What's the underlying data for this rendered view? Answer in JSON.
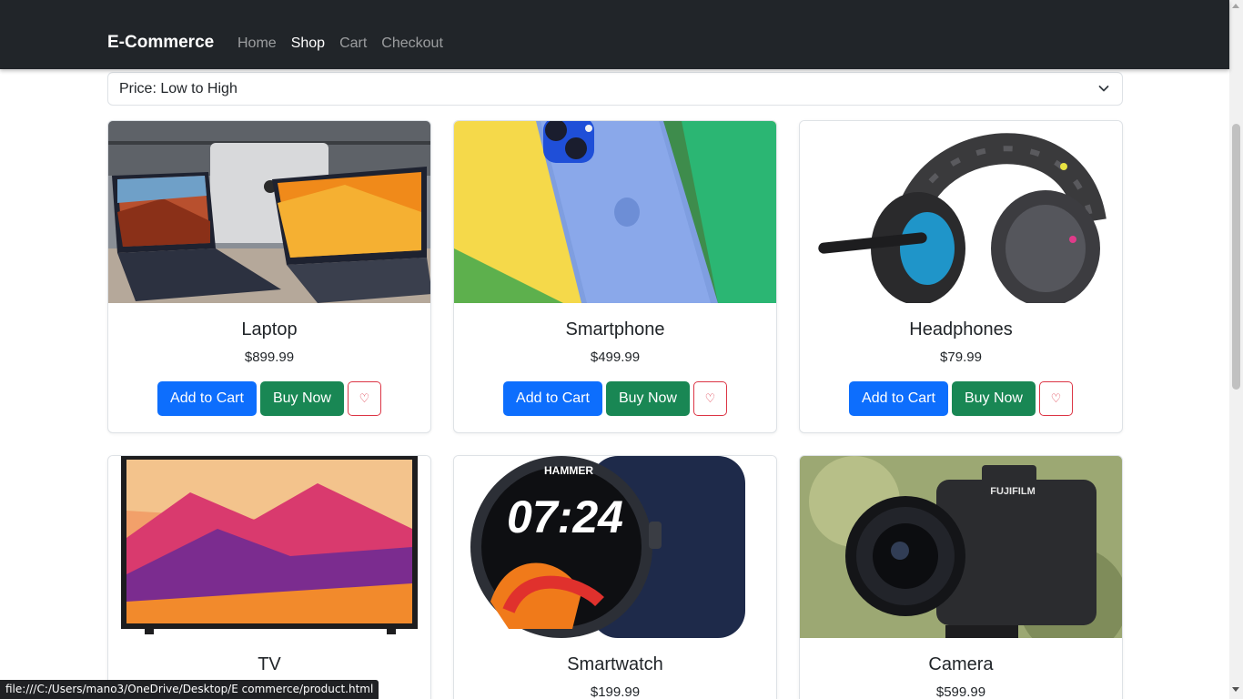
{
  "navbar": {
    "brand": "E-Commerce",
    "links": [
      {
        "label": "Home",
        "active": false
      },
      {
        "label": "Shop",
        "active": true
      },
      {
        "label": "Cart",
        "active": false
      },
      {
        "label": "Checkout",
        "active": false
      }
    ]
  },
  "sort": {
    "selected": "Price: Low to High"
  },
  "products": [
    {
      "name": "Laptop",
      "price": "$899.99",
      "add_to_cart": "Add to Cart",
      "buy_now": "Buy Now",
      "wishlist": "♡"
    },
    {
      "name": "Smartphone",
      "price": "$499.99",
      "add_to_cart": "Add to Cart",
      "buy_now": "Buy Now",
      "wishlist": "♡"
    },
    {
      "name": "Headphones",
      "price": "$79.99",
      "add_to_cart": "Add to Cart",
      "buy_now": "Buy Now",
      "wishlist": "♡"
    },
    {
      "name": "TV",
      "price": "",
      "add_to_cart": "",
      "buy_now": "",
      "wishlist": ""
    },
    {
      "name": "Smartwatch",
      "price": "$199.99",
      "add_to_cart": "",
      "buy_now": "",
      "wishlist": ""
    },
    {
      "name": "Camera",
      "price": "$599.99",
      "add_to_cart": "",
      "buy_now": "",
      "wishlist": ""
    }
  ],
  "image_labels": {
    "watch_brand": "HAMMER",
    "watch_time": "07:24",
    "camera_brand": "FUJIFILM"
  },
  "statusbar": {
    "url": "file:///C:/Users/mano3/OneDrive/Desktop/E commerce/product.html"
  },
  "colors": {
    "navbar_bg": "#212529",
    "primary": "#0d6efd",
    "success": "#198754",
    "danger": "#dc3545"
  }
}
